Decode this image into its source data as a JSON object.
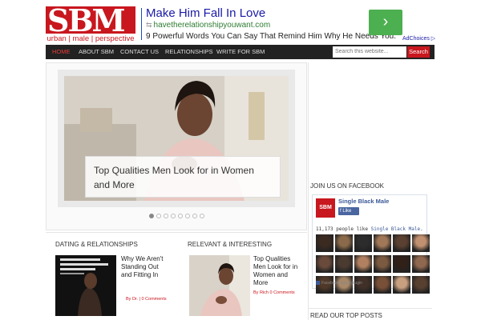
{
  "logo": {
    "mark": "SBM",
    "tagline": "urban | male | perspective"
  },
  "ad": {
    "title": "Make Him Fall In Love",
    "url": "havetherelationshipyouwant.com",
    "description": "9 Powerful Words You Can Say That Remind Him Why He Needs You.",
    "arrow": "›",
    "adchoices": "AdChoices ▷"
  },
  "nav": {
    "items": [
      "HOME",
      "ABOUT SBM",
      "CONTACT US",
      "RELATIONSHIPS",
      "WRITE FOR SBM"
    ],
    "search_placeholder": "Search this website...",
    "search_button": "Search"
  },
  "slider": {
    "caption": "Top Qualities Men Look for in Women and More",
    "dot_count": 8,
    "active_dot": 0
  },
  "sidebar": {
    "facebook_heading": "JOIN US ON FACEBOOK",
    "fb_logo": "SBM",
    "page_name": "Single Black Male",
    "like_label": "Like",
    "people_like": "11,173 people like ",
    "people_like_link": "Single Black Male",
    "people_like_end": ".",
    "plugin_label": "Facebook social plugin",
    "top_posts_heading": "READ OUR TOP POSTS"
  },
  "columns": [
    {
      "heading": "DATING & RELATIONSHIPS",
      "post_title": "Why We Aren't Standing Out and Fitting In",
      "post_meta": "By Dr. | 0 Comments"
    },
    {
      "heading": "RELEVANT & INTERESTING",
      "post_title": "Top Qualities Men Look for in Women and More",
      "post_meta": "By Rich 0 Comments"
    }
  ],
  "colors": {
    "brand_red": "#c8171e",
    "nav_bg": "#222222",
    "ad_green": "#4caf50",
    "fb_blue": "#3b5998"
  }
}
